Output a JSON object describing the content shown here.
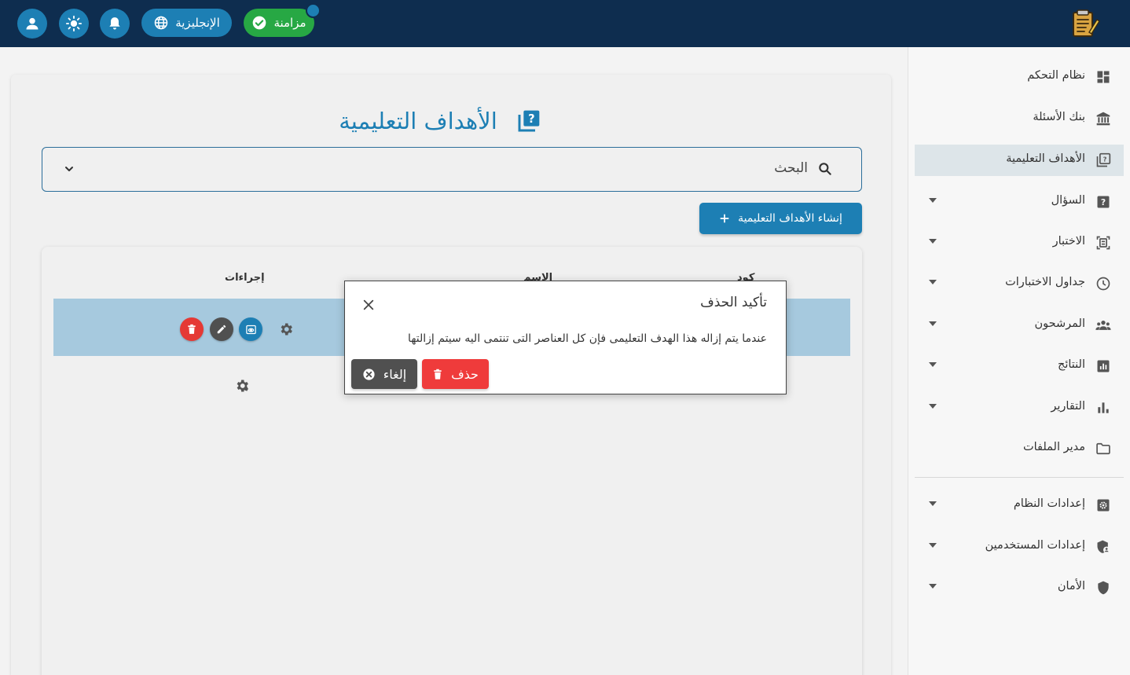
{
  "topbar": {
    "sync_label": "مزامنة",
    "language_label": "الإنجليزية",
    "buttons": [
      "user-profile",
      "theme-toggle",
      "notifications"
    ]
  },
  "sidebar": {
    "items": [
      {
        "label": "نظام التحكم",
        "icon": "dashboard-icon",
        "has_submenu": false
      },
      {
        "label": "بنك الأسئلة",
        "icon": "bank-icon",
        "has_submenu": false
      },
      {
        "label": "الأهداف التعليمية",
        "icon": "quiz-book-icon",
        "has_submenu": false,
        "active": true
      },
      {
        "label": "السؤال",
        "icon": "question-icon",
        "has_submenu": true
      },
      {
        "label": "الاختبار",
        "icon": "exam-icon",
        "has_submenu": true
      },
      {
        "label": "جداول الاختبارات",
        "icon": "clock-icon",
        "has_submenu": true
      },
      {
        "label": "المرشحون",
        "icon": "people-icon",
        "has_submenu": true
      },
      {
        "label": "النتائج",
        "icon": "results-icon",
        "has_submenu": true
      },
      {
        "label": "التقارير",
        "icon": "bar-chart-icon",
        "has_submenu": true
      },
      {
        "label": "مدير الملفات",
        "icon": "folder-icon",
        "has_submenu": false
      },
      {
        "label": "إعدادات النظام",
        "icon": "settings-icon",
        "has_submenu": true
      },
      {
        "label": "إعدادات المستخدمين",
        "icon": "user-security-icon",
        "has_submenu": true
      },
      {
        "label": "الأمان",
        "icon": "shield-icon",
        "has_submenu": true
      }
    ]
  },
  "main": {
    "title": "الأهداف التعليمية",
    "search_label": "البحث",
    "create_button": "إنشاء الأهداف التعليمية",
    "table": {
      "headers": {
        "code": "كود",
        "name": "الاسم",
        "actions": "إجراءات"
      }
    }
  },
  "modal": {
    "title": "تأكيد الحذف",
    "message": "عندما يتم إزاله هذا الهدف التعليمى فإن كل العناصر التى تنتمى اليه سيتم إزالتها",
    "delete_label": "حذف",
    "cancel_label": "إلغاء"
  },
  "colors": {
    "topbar": "#0e2d4f",
    "primary": "#1d7fb4",
    "success": "#27a844",
    "danger": "#ef3b3b",
    "neutral": "#505050",
    "row_highlight": "#a6c9de"
  }
}
